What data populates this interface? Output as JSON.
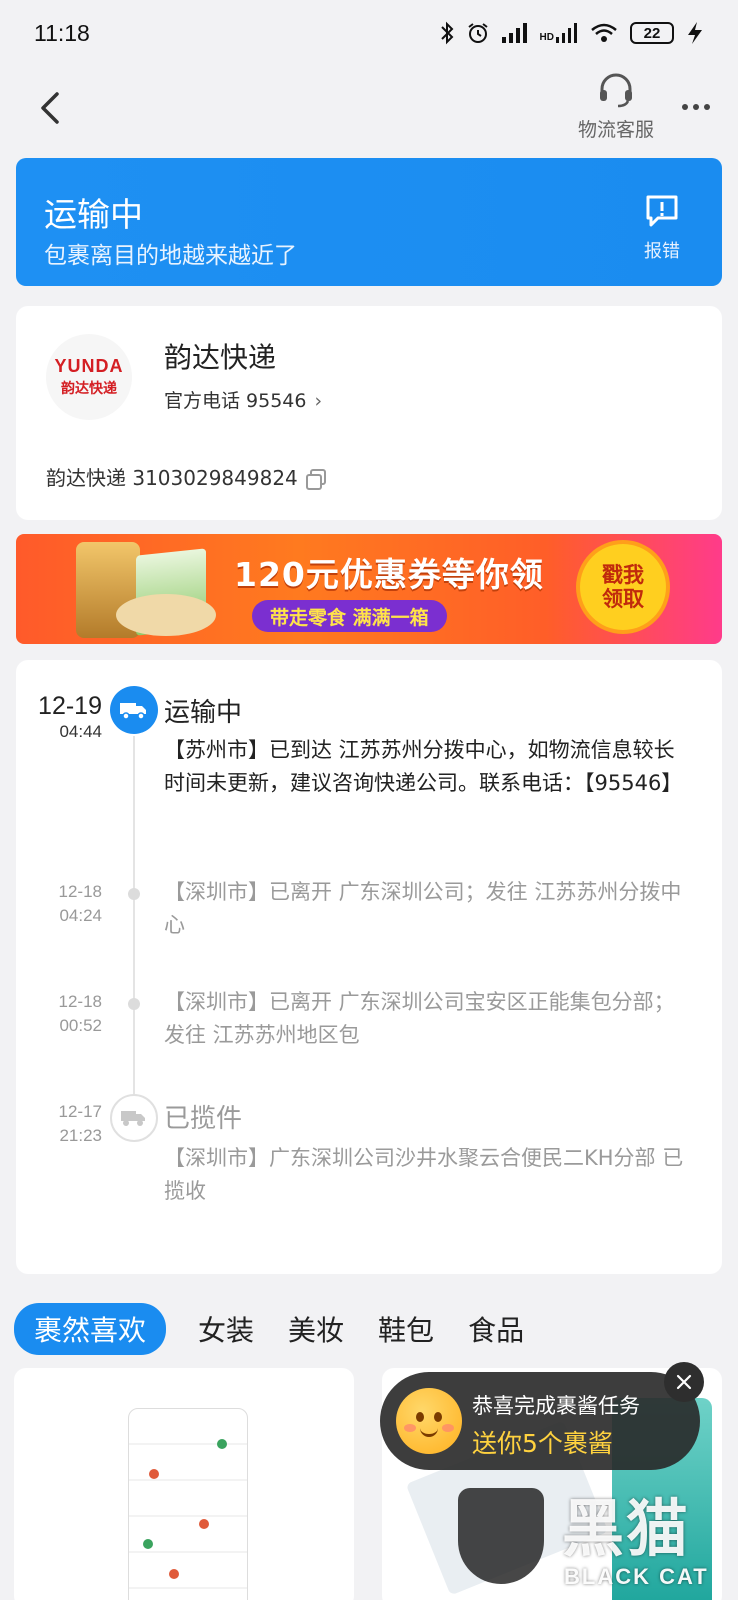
{
  "status_bar": {
    "time": "11:18",
    "battery": "22",
    "network": "HD"
  },
  "nav": {
    "customer_service_label": "物流客服"
  },
  "banner": {
    "title": "运输中",
    "subtitle": "包裹离目的地越来越近了",
    "report_label": "报错"
  },
  "courier": {
    "logo_text": "YUNDA",
    "logo_sub": "韵达快递",
    "name": "韵达快递",
    "phone": "官方电话 95546",
    "tracking": "韵达快递 3103029849824"
  },
  "promo": {
    "headline": "120元优惠券等你领",
    "tagline": "带走零食 满满一箱",
    "button_line1": "戳我",
    "button_line2": "领取"
  },
  "timeline": [
    {
      "date": "12-19",
      "time": "04:44",
      "status": "运输中",
      "text": "【苏州市】已到达 江苏苏州分拨中心，如物流信息较长时间未更新，建议咨询快递公司。联系电话：【95546】"
    },
    {
      "date": "12-18",
      "time": "04:24",
      "status": "",
      "text": "【深圳市】已离开 广东深圳公司；发往 江苏苏州分拨中心"
    },
    {
      "date": "12-18",
      "time": "00:52",
      "status": "",
      "text": "【深圳市】已离开 广东深圳公司宝安区正能集包分部；发往 江苏苏州地区包"
    },
    {
      "date": "12-17",
      "time": "21:23",
      "status": "已揽件",
      "text": "【深圳市】广东深圳公司沙井水聚云合便民二KH分部 已揽收"
    }
  ],
  "tabs": [
    "裹然喜欢",
    "女装",
    "美妆",
    "鞋包",
    "食品"
  ],
  "toast": {
    "line1": "恭喜完成裹酱任务",
    "line2": "送你5个裹酱"
  },
  "watermark": {
    "cn": "黑猫",
    "en": "BLACK CAT"
  },
  "colors": {
    "accent": "#1a8cf0",
    "promo": "#ff6a24",
    "toast_highlight": "#ffd23f"
  }
}
